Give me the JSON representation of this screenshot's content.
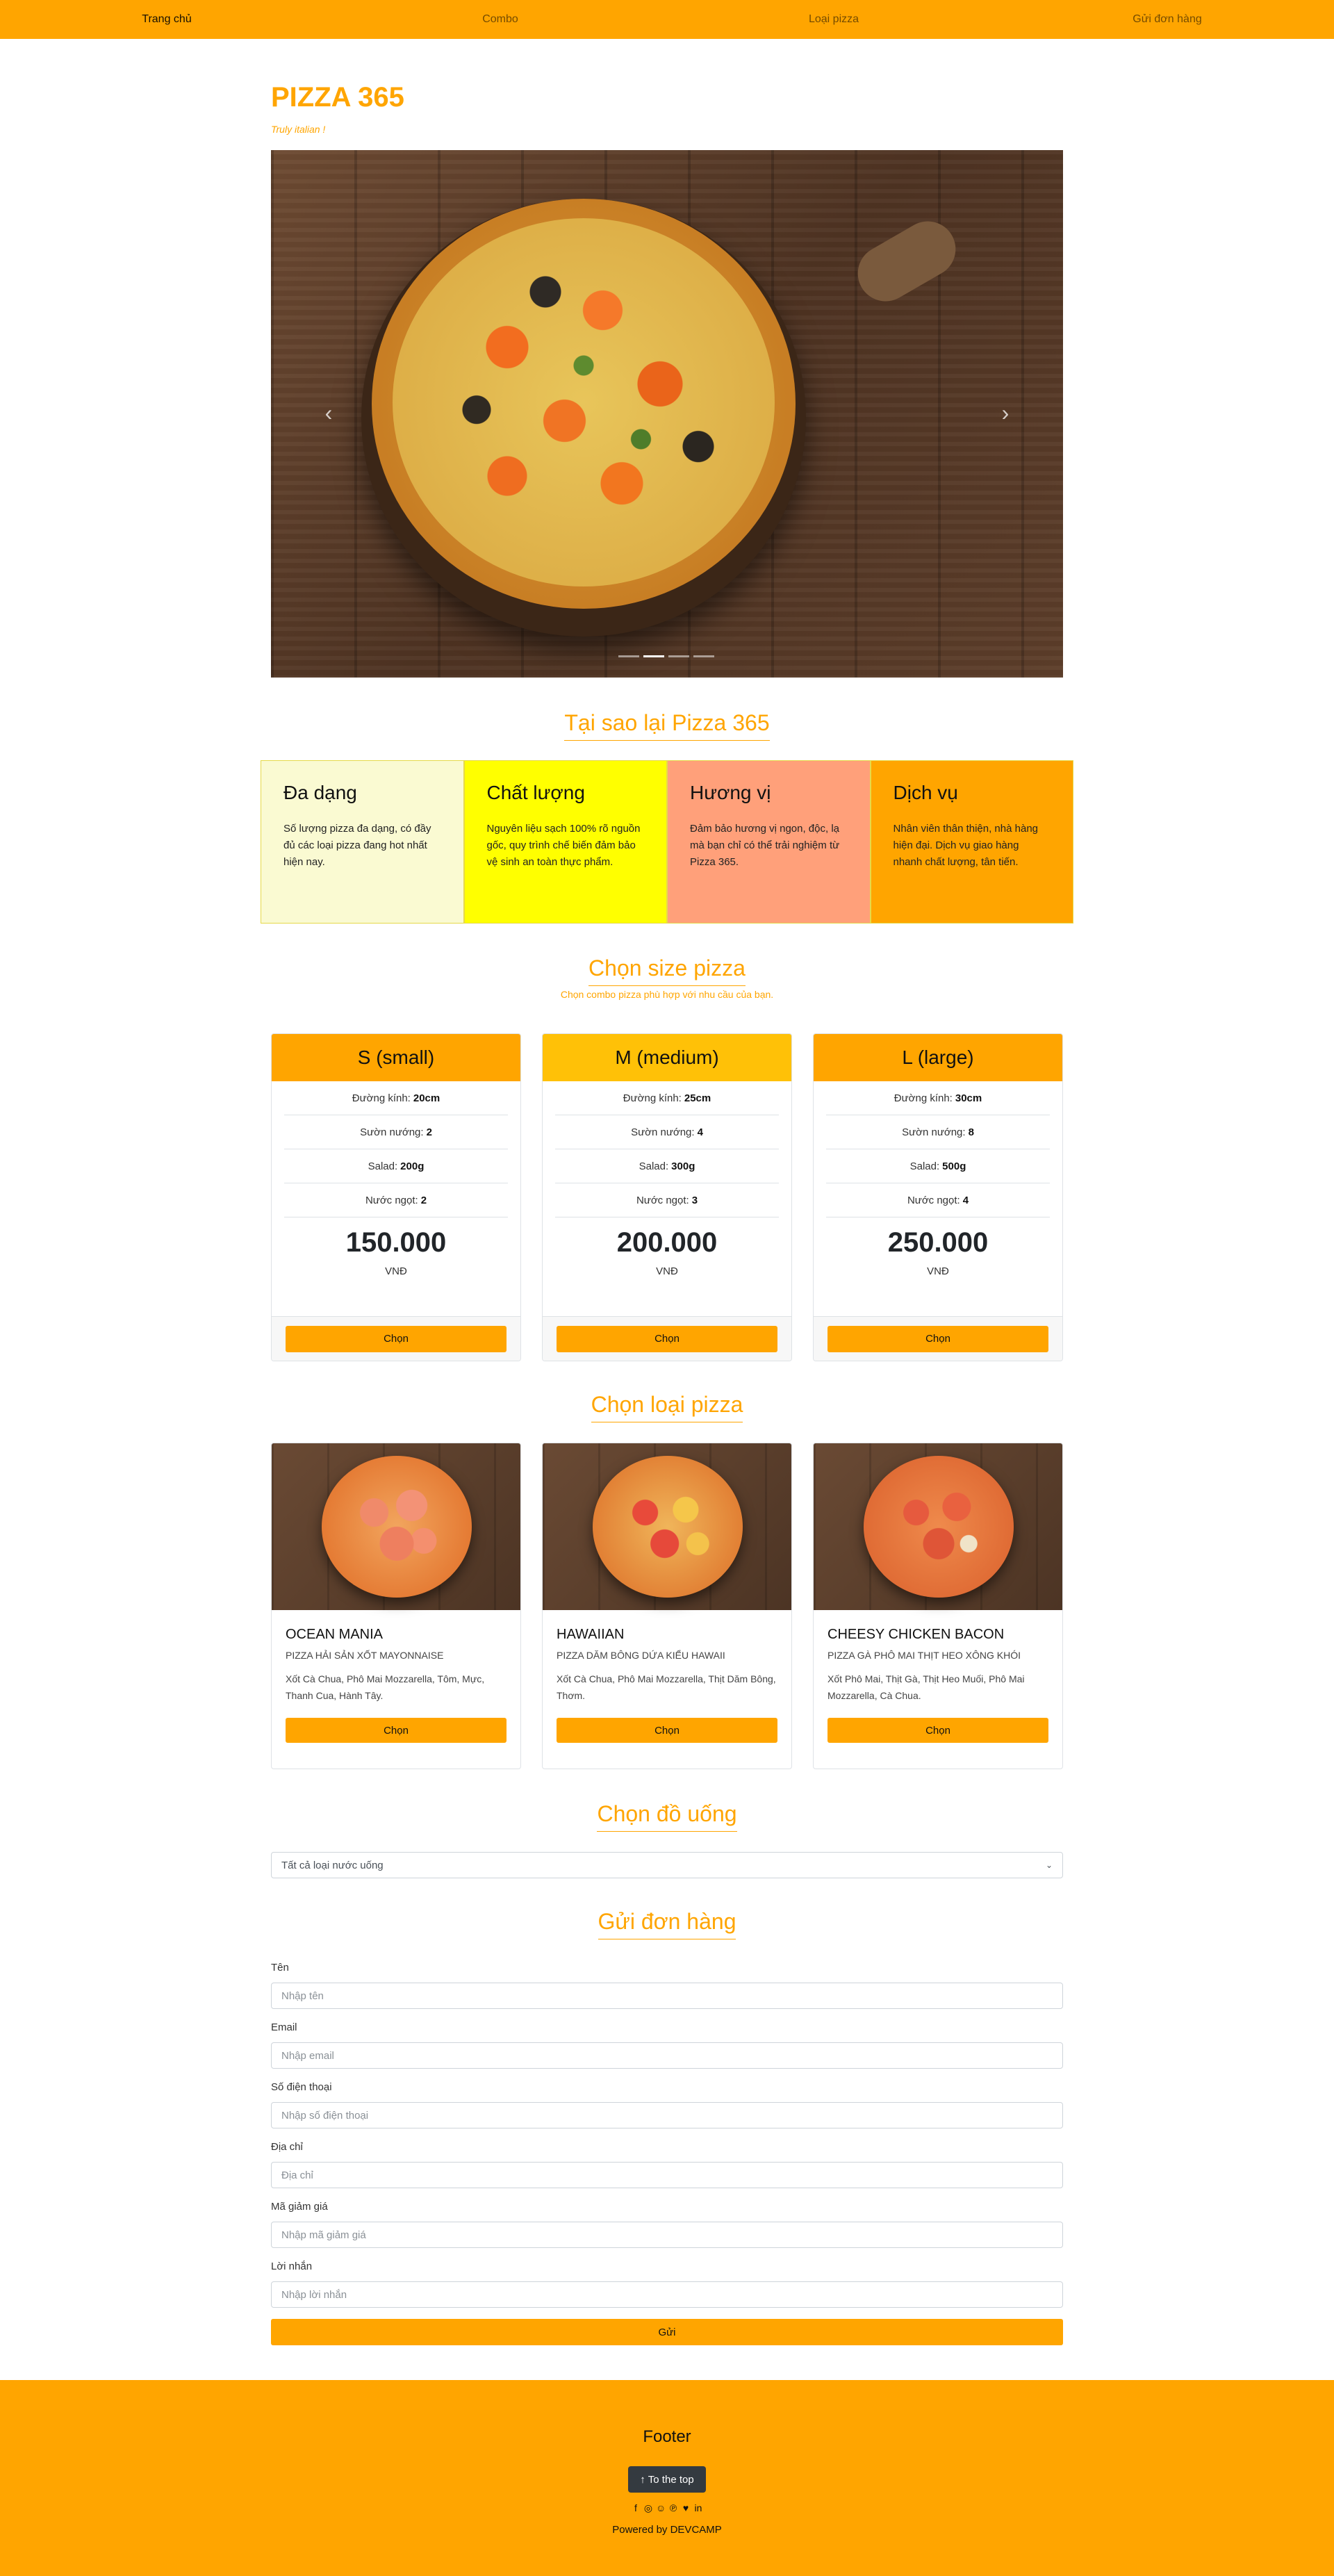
{
  "nav": {
    "items": [
      {
        "label": "Trang chủ"
      },
      {
        "label": "Combo"
      },
      {
        "label": "Loại pizza"
      },
      {
        "label": "Gửi đơn hàng"
      }
    ]
  },
  "brand": {
    "title": "PIZZA 365",
    "tagline": "Truly italian !"
  },
  "carousel": {
    "prev_icon": "chevron-left-icon",
    "next_icon": "chevron-right-icon",
    "slide_count": 4,
    "active_slide": 2
  },
  "why": {
    "heading": "Tại sao lại Pizza 365",
    "boxes": [
      {
        "title": "Đa dạng",
        "text": "Số lượng pizza đa dạng, có đầy đủ các loại pizza đang hot nhất hiện nay.",
        "color": "#FAFAD2"
      },
      {
        "title": "Chất lượng",
        "text": "Nguyên liệu sạch 100% rõ nguồn gốc, quy trình chế biến đảm bảo vệ sinh an toàn thực phẩm.",
        "color": "#FFFF00"
      },
      {
        "title": "Hương vị",
        "text": "Đảm bảo hương vị ngon, độc, lạ mà bạn chỉ có thể trải nghiệm từ Pizza 365.",
        "color": "#FFA07A"
      },
      {
        "title": "Dịch vụ",
        "text": "Nhân viên thân thiện, nhà hàng hiện đại. Dịch vụ giao hàng nhanh chất lượng, tân tiến.",
        "color": "#FFA500"
      }
    ]
  },
  "sizes": {
    "heading": "Chọn size pizza",
    "subheading": "Chọn combo pizza phù hợp với nhu cầu của bạn.",
    "labels": {
      "diameter": "Đường kính:",
      "ribs": "Sườn nướng:",
      "salad": "Salad:",
      "drink": "Nước ngọt:"
    },
    "cards": [
      {
        "name": "S (small)",
        "diameter": "20cm",
        "ribs": "2",
        "salad": "200g",
        "drink": "2",
        "price": "150.000",
        "unit": "VNĐ",
        "button": "Chọn",
        "header_color": "#FFA500"
      },
      {
        "name": "M (medium)",
        "diameter": "25cm",
        "ribs": "4",
        "salad": "300g",
        "drink": "3",
        "price": "200.000",
        "unit": "VNĐ",
        "button": "Chọn",
        "header_color": "#FFC107"
      },
      {
        "name": "L (large)",
        "diameter": "30cm",
        "ribs": "8",
        "salad": "500g",
        "drink": "4",
        "price": "250.000",
        "unit": "VNĐ",
        "button": "Chọn",
        "header_color": "#FFA500"
      }
    ]
  },
  "types": {
    "heading": "Chọn loại pizza",
    "cards": [
      {
        "name": "OCEAN MANIA",
        "desc": "PIZZA HẢI SẢN XỐT MAYONNAISE",
        "ingredients": "Xốt Cà Chua, Phô Mai Mozzarella, Tôm, Mực, Thanh Cua, Hành Tây.",
        "button": "Chọn"
      },
      {
        "name": "HAWAIIAN",
        "desc": "PIZZA DĂM BÔNG DỨA KIỂU HAWAII",
        "ingredients": "Xốt Cà Chua, Phô Mai Mozzarella, Thịt Dăm Bông, Thơm.",
        "button": "Chọn"
      },
      {
        "name": "CHEESY CHICKEN BACON",
        "desc": "PIZZA GÀ PHÔ MAI THỊT HEO XÔNG KHÓI",
        "ingredients": "Xốt Phô Mai, Thịt Gà, Thịt Heo Muối, Phô Mai Mozzarella, Cà Chua.",
        "button": "Chọn"
      }
    ]
  },
  "drinks": {
    "heading": "Chọn đồ uống",
    "selected": "Tất cả loại nước uống"
  },
  "order": {
    "heading": "Gửi đơn hàng",
    "fields": [
      {
        "label": "Tên",
        "placeholder": "Nhập tên",
        "value": ""
      },
      {
        "label": "Email",
        "placeholder": "Nhập email",
        "value": ""
      },
      {
        "label": "Số điện thoại",
        "placeholder": "Nhập số điện thoại",
        "value": ""
      },
      {
        "label": "Địa chỉ",
        "placeholder": "Địa chỉ",
        "value": ""
      },
      {
        "label": "Mã giảm giá",
        "placeholder": "Nhập mã giảm giá",
        "value": ""
      },
      {
        "label": "Lời nhắn",
        "placeholder": "Nhập lời nhắn",
        "value": ""
      }
    ],
    "submit": "Gửi"
  },
  "footer": {
    "title": "Footer",
    "to_top": "To the top",
    "to_top_icon": "arrow-up-icon",
    "social": [
      "facebook-icon",
      "instagram-icon",
      "snapchat-icon",
      "pinterest-icon",
      "twitter-icon",
      "linkedin-icon"
    ],
    "powered": "Powered by DEVCAMP"
  },
  "colors": {
    "accent": "#FFA500",
    "dark_button": "#343a40"
  }
}
